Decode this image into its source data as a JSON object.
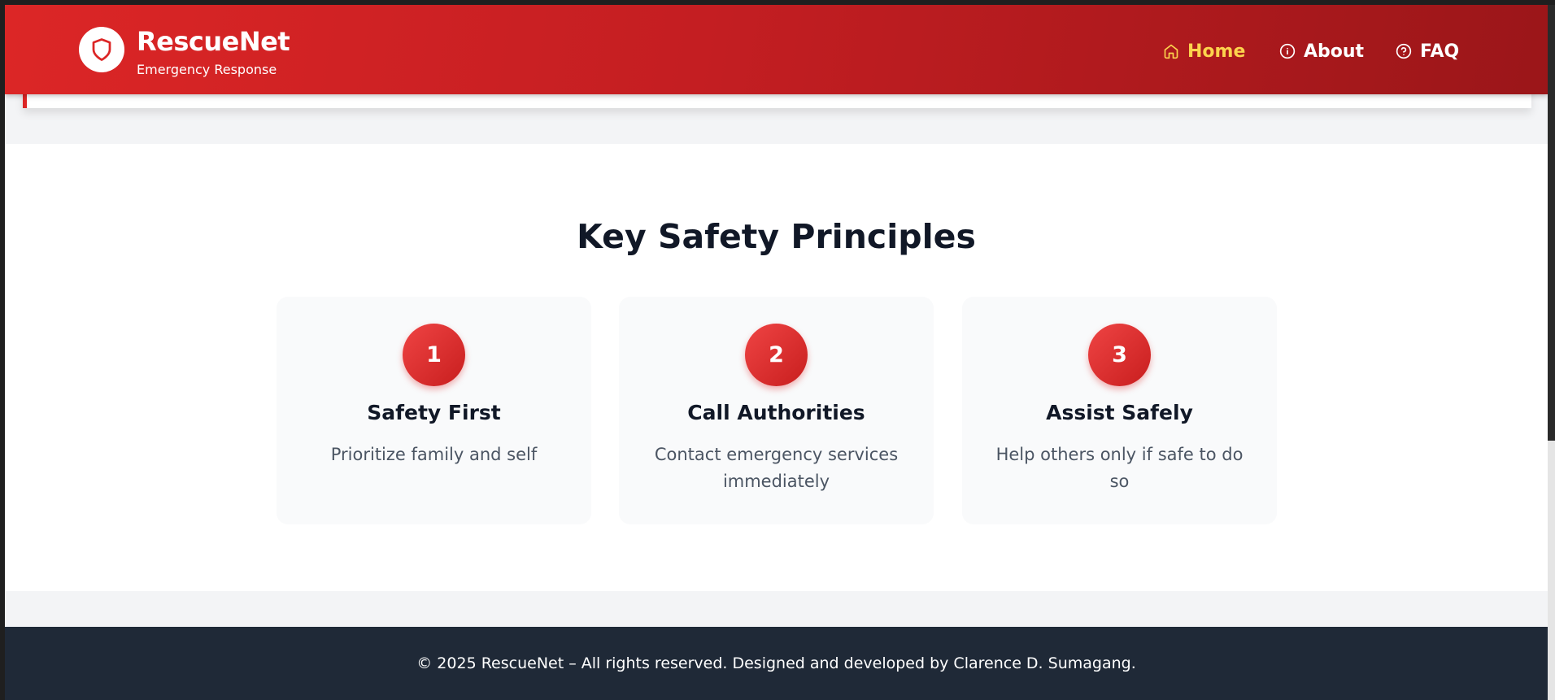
{
  "header": {
    "brand_title": "RescueNet",
    "brand_subtitle": "Emergency Response",
    "logo_icon": "shield-icon",
    "nav": [
      {
        "label": "Home",
        "icon": "home-icon",
        "active": true
      },
      {
        "label": "About",
        "icon": "info-icon",
        "active": false
      },
      {
        "label": "FAQ",
        "icon": "help-circle-icon",
        "active": false
      }
    ]
  },
  "principles": {
    "title": "Key Safety Principles",
    "cards": [
      {
        "number": "1",
        "title": "Safety First",
        "text": "Prioritize family and self"
      },
      {
        "number": "2",
        "title": "Call Authorities",
        "text": "Contact emergency services immediately"
      },
      {
        "number": "3",
        "title": "Assist Safely",
        "text": "Help others only if safe to do so"
      }
    ]
  },
  "footer": {
    "text": "© 2025 RescueNet – All rights reserved. Designed and developed by Clarence D. Sumagang."
  },
  "colors": {
    "primary": "#dc2626",
    "accent_active": "#fcd34d",
    "footer_bg": "#1f2937"
  }
}
